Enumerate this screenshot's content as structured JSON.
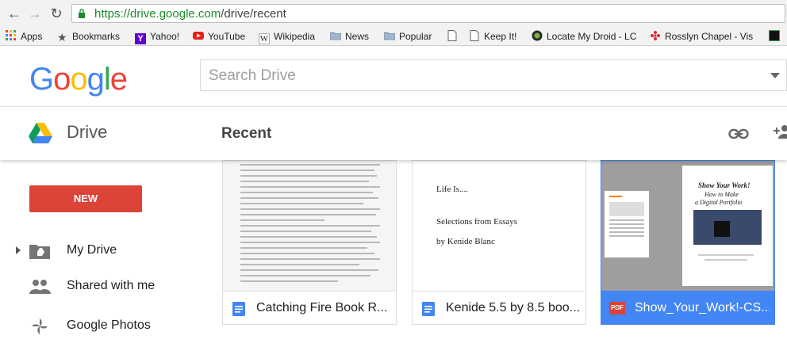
{
  "browser": {
    "url_host": "https://drive.google.com",
    "url_path": "/drive/recent",
    "bookmarks": [
      {
        "label": "Apps",
        "icon": "apps-grid-icon"
      },
      {
        "label": "Bookmarks",
        "icon": "star-icon"
      },
      {
        "label": "Yahoo!",
        "icon": "yahoo-icon"
      },
      {
        "label": "YouTube",
        "icon": "youtube-icon"
      },
      {
        "label": "Wikipedia",
        "icon": "wikipedia-icon"
      },
      {
        "label": "News",
        "icon": "folder-icon"
      },
      {
        "label": "Popular",
        "icon": "folder-icon"
      },
      {
        "label": "",
        "icon": "page-icon"
      },
      {
        "label": "Keep It!",
        "icon": "page-icon"
      },
      {
        "label": "Locate My Droid - LC",
        "icon": "droid-icon"
      },
      {
        "label": "Rosslyn Chapel - Vis",
        "icon": "flower-icon"
      }
    ]
  },
  "header": {
    "logo": "Google",
    "search_placeholder": "Search Drive"
  },
  "drivebar": {
    "app_name": "Drive",
    "page_title": "Recent"
  },
  "sidebar": {
    "new_label": "NEW",
    "items": [
      {
        "label": "My Drive",
        "icon": "my-drive-icon"
      },
      {
        "label": "Shared with me",
        "icon": "people-icon"
      },
      {
        "label": "Google Photos",
        "icon": "pinwheel-icon"
      }
    ]
  },
  "files": [
    {
      "name": "Catching Fire Book R...",
      "type": "doc"
    },
    {
      "name": "Kenide 5.5 by 8.5 boo...",
      "type": "doc",
      "preview": {
        "title": "Life Is....",
        "subtitle": "Selections from Essays",
        "author": "by Kenide Blanc"
      }
    },
    {
      "name": "Show_Your_Work!-CS...",
      "type": "pdf",
      "selected": true,
      "preview": {
        "title1": "Show Your Work!",
        "title2": "How to Make",
        "title3": "a Digital Portfolio",
        "badge": "PDF"
      }
    }
  ],
  "colors": {
    "new_button": "#db4437",
    "selected": "#4285f4",
    "url_green": "#1a8a2a"
  }
}
